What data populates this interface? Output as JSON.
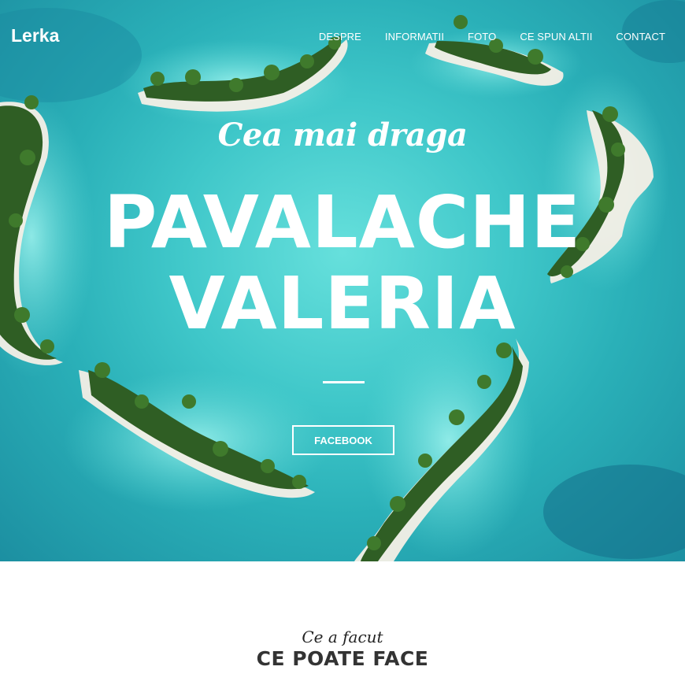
{
  "brand": {
    "logo": "Lerka"
  },
  "nav": {
    "items": [
      {
        "label": "DESPRE"
      },
      {
        "label": "INFORMATII"
      },
      {
        "label": "FOTO"
      },
      {
        "label": "CE SPUN ALTII"
      },
      {
        "label": "CONTACT"
      }
    ]
  },
  "hero": {
    "script_title": "Cea mai draga",
    "name_line1": "PAVALACHE",
    "name_line2": "VALERIA",
    "button_label": "FACEBOOK",
    "image": "heart-shaped-island-lagoon"
  },
  "section": {
    "script_subtitle": "Ce a facut",
    "title": "CE POATE FACE"
  },
  "colors": {
    "lagoon": "#3fc7c9",
    "deep_water": "#1c8fa1",
    "sand": "#f4efe6",
    "palm": "#2f5e24",
    "text_light": "#ffffff",
    "heading_dark": "#333333"
  }
}
